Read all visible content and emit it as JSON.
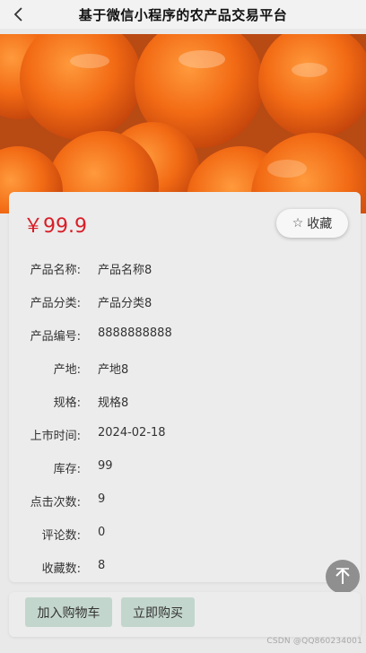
{
  "header": {
    "title": "基于微信小程序的农产品交易平台",
    "back_icon": "chevron-left-icon"
  },
  "product": {
    "price": "￥99.9",
    "favorite_label": "收藏",
    "favorite_icon": "star-outline-icon",
    "image_icon": "persimmon-photo",
    "fields": [
      {
        "label": "产品名称:",
        "value": "产品名称8"
      },
      {
        "label": "产品分类:",
        "value": "产品分类8"
      },
      {
        "label": "产品编号:",
        "value": "8888888888"
      },
      {
        "label": "产地:",
        "value": "产地8"
      },
      {
        "label": "规格:",
        "value": "规格8"
      },
      {
        "label": "上市时间:",
        "value": "2024-02-18"
      },
      {
        "label": "库存:",
        "value": "99"
      },
      {
        "label": "点击次数:",
        "value": "9"
      },
      {
        "label": "评论数:",
        "value": "0"
      },
      {
        "label": "收藏数:",
        "value": "8"
      }
    ]
  },
  "actions": {
    "add_to_cart": "加入购物车",
    "buy_now": "立即购买"
  },
  "scroll_top_icon": "arrow-up-icon",
  "watermark": "CSDN @QQ860234001",
  "colors": {
    "price": "#d81e28",
    "button_bg": "#c3d6cd",
    "page_bg": "#e9e9e9"
  }
}
